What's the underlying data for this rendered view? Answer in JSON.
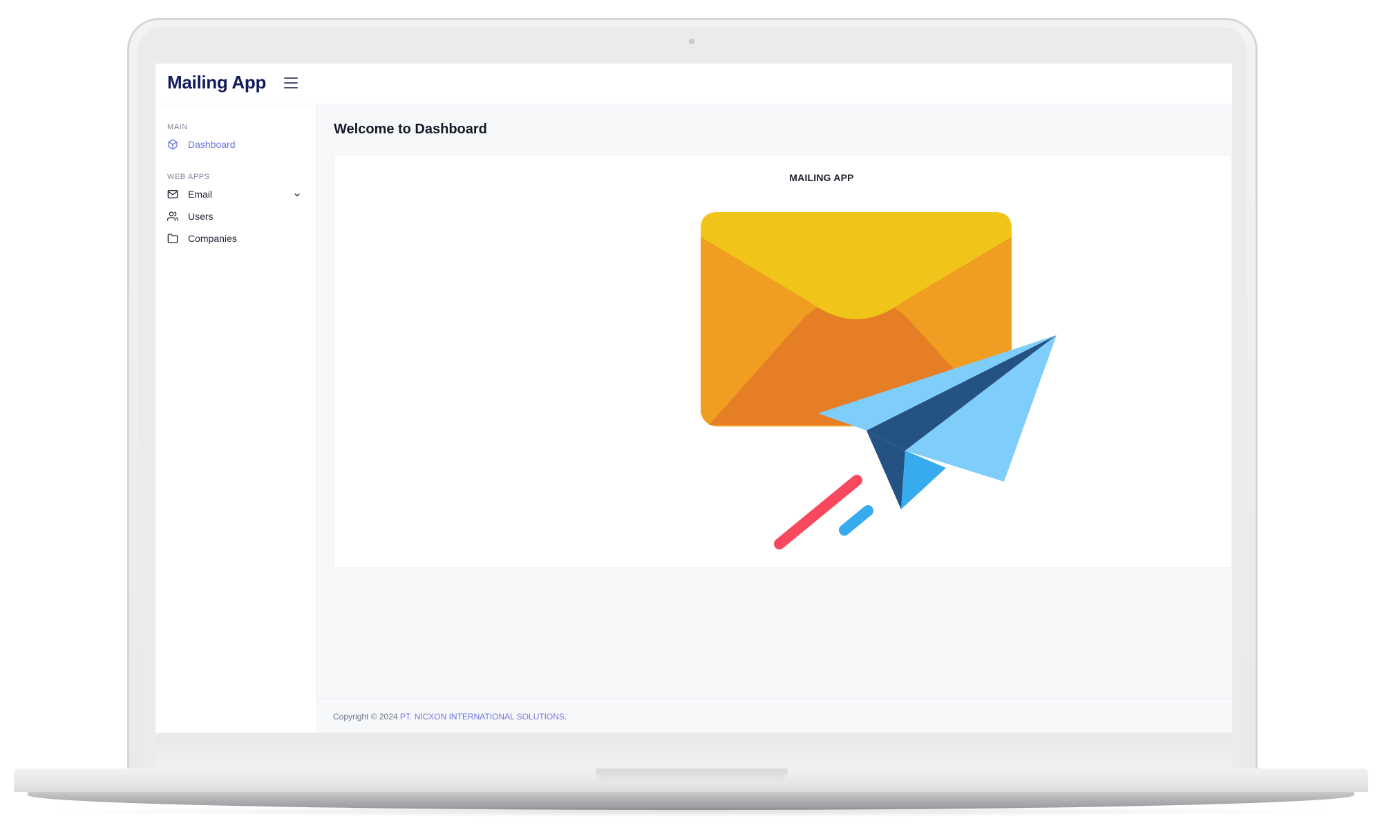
{
  "app": {
    "title": "Mailing App"
  },
  "sidebar": {
    "sections": [
      {
        "label": "MAIN",
        "items": [
          {
            "label": "Dashboard",
            "icon": "cube-icon",
            "active": true
          }
        ]
      },
      {
        "label": "WEB APPS",
        "items": [
          {
            "label": "Email",
            "icon": "mail-icon",
            "has_submenu": true
          },
          {
            "label": "Users",
            "icon": "users-icon"
          },
          {
            "label": "Companies",
            "icon": "folder-icon"
          }
        ]
      }
    ]
  },
  "main": {
    "page_title": "Welcome to Dashboard",
    "card": {
      "title": "MAILING APP"
    }
  },
  "footer": {
    "copyright_prefix": "Copyright © 2024 ",
    "company_link": "PT. NICXON INTERNATIONAL SOLUTIONS",
    "suffix": "."
  },
  "colors": {
    "brand_navy": "#101b5c",
    "accent": "#6d76e3",
    "envelope_top": "#f0c419",
    "envelope_side": "#f09e21",
    "envelope_bottom": "#e57e25",
    "plane_light": "#7fcdfb",
    "plane_dark": "#245282",
    "plane_mid": "#36abee",
    "streak_red": "#f7485e"
  }
}
